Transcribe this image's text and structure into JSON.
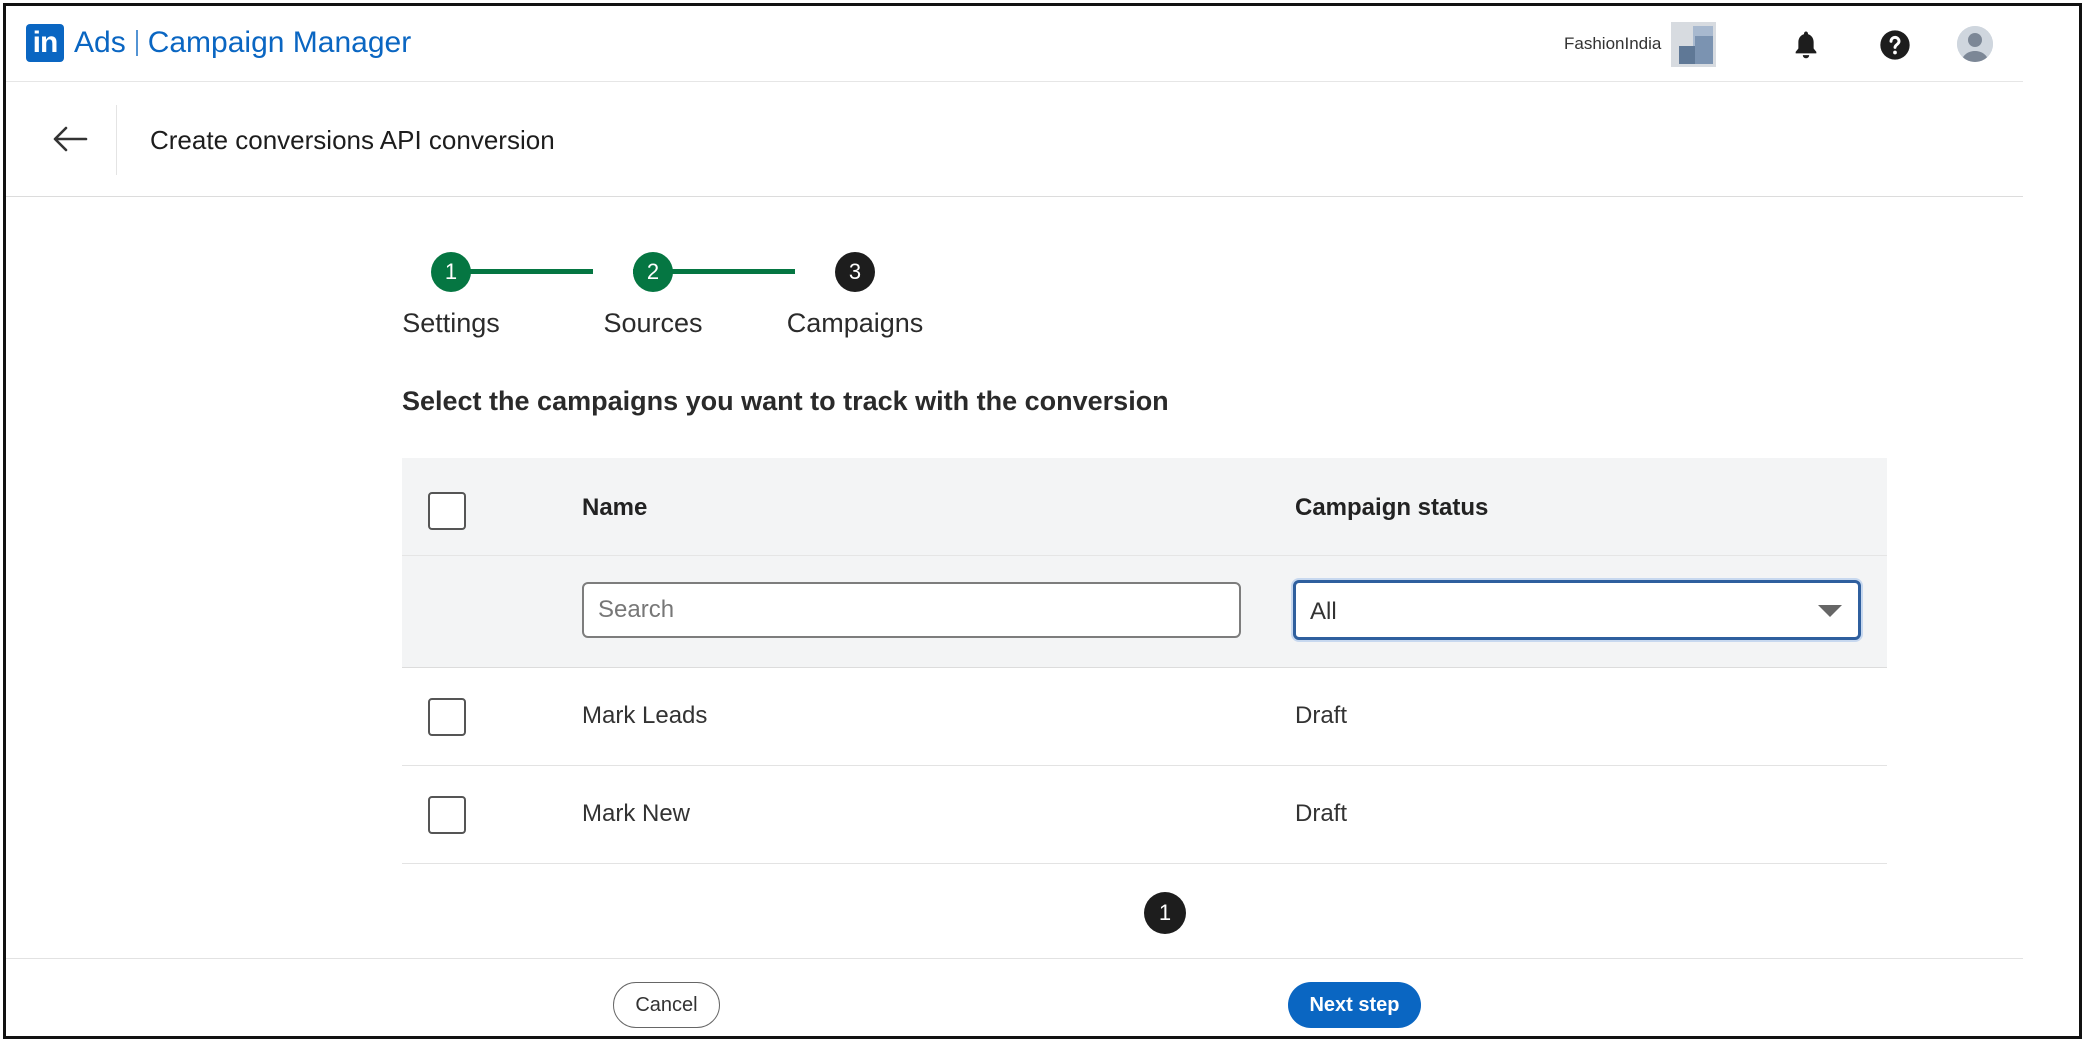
{
  "topnav": {
    "logo_text": "in",
    "product": "Ads",
    "app_name": "Campaign Manager",
    "account_name": "FashionIndia",
    "icons": [
      "bell-icon",
      "help-icon",
      "avatar"
    ]
  },
  "header": {
    "title": "Create conversions API conversion",
    "back_icon": "arrow-left-icon"
  },
  "stepper": {
    "steps": [
      {
        "number": "1",
        "label": "Settings",
        "state": "done"
      },
      {
        "number": "2",
        "label": "Sources",
        "state": "done"
      },
      {
        "number": "3",
        "label": "Campaigns",
        "state": "current"
      }
    ]
  },
  "section": {
    "title": "Select the campaigns you want to track with the conversion"
  },
  "table": {
    "columns": {
      "name": "Name",
      "status": "Campaign status"
    },
    "search_placeholder": "Search",
    "status_filter_value": "All",
    "rows": [
      {
        "name": "Mark Leads",
        "status": "Draft"
      },
      {
        "name": "Mark New",
        "status": "Draft"
      }
    ]
  },
  "pagination": {
    "current_page": "1"
  },
  "footer": {
    "cancel_label": "Cancel",
    "next_label": "Next step"
  },
  "colors": {
    "brand": "#0a66c2",
    "step_done": "#057642",
    "step_current": "#1d1d1d"
  }
}
